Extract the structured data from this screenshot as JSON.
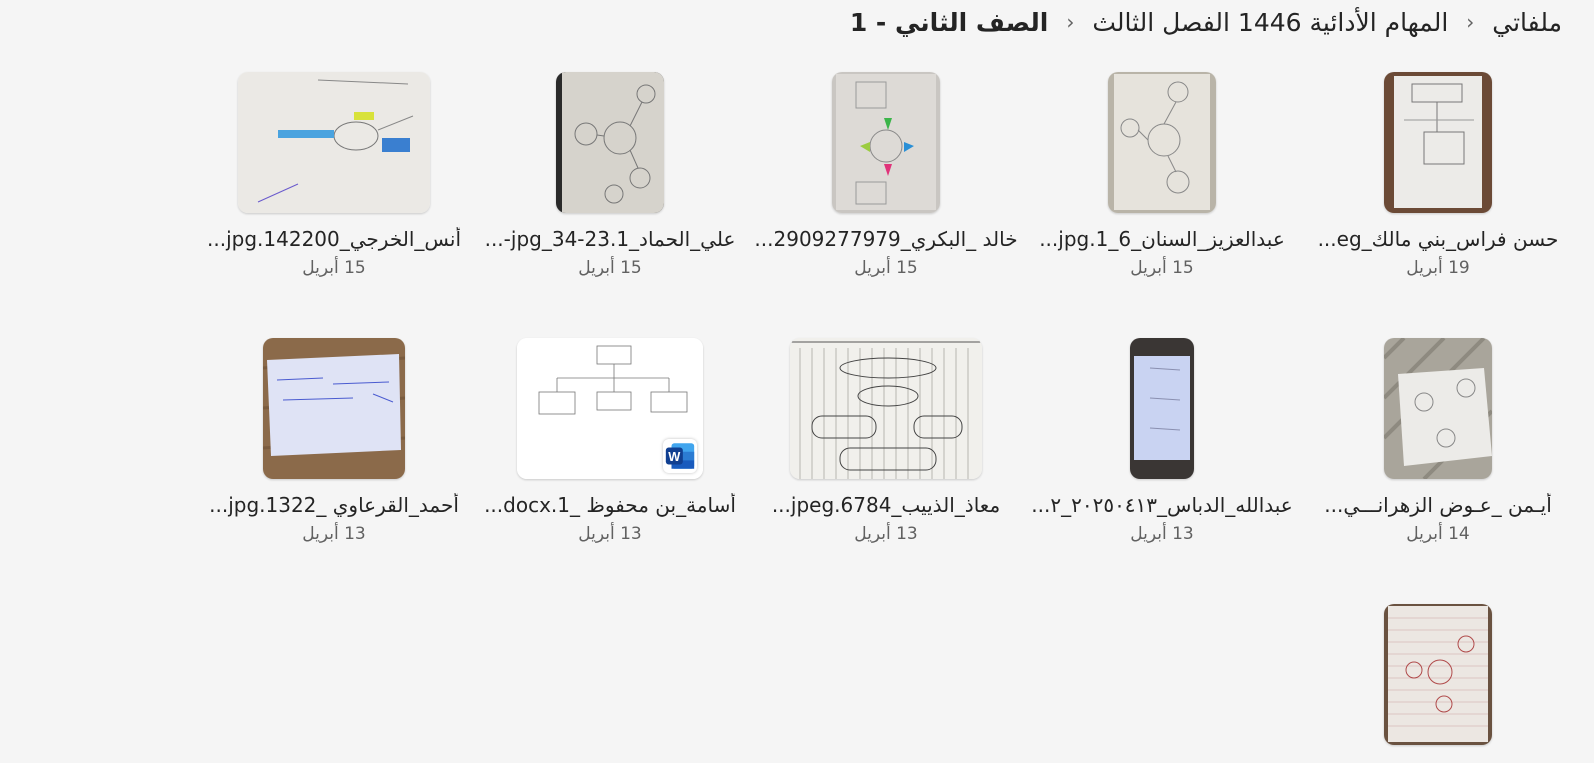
{
  "breadcrumb": {
    "items": [
      {
        "label": "ملفاتي"
      },
      {
        "label": "المهام الأدائية 1446 الفصل الثالث"
      },
      {
        "label": "الصف الثاني - 1"
      }
    ],
    "separator_icon": "chevron-left-icon"
  },
  "files": [
    {
      "name": "حسن فراس_بني مالك_eg...",
      "date": "19 أبريل",
      "type": "image"
    },
    {
      "name": "عبدالعزيز_السنان_6_1.jpg...",
      "date": "15 أبريل",
      "type": "image"
    },
    {
      "name": "خالد _البكري_2909277979...",
      "date": "15 أبريل",
      "type": "image"
    },
    {
      "name": "علي_الحماد_1.jpg_34-23-...",
      "date": "15 أبريل",
      "type": "image"
    },
    {
      "name": "أنس_الخرجي_142200.jpg...",
      "date": "15 أبريل",
      "type": "image"
    },
    {
      "name": "أيـمن _عـوض الزهرانـــي...",
      "date": "14 أبريل",
      "type": "image"
    },
    {
      "name": "عبدالله_الدباس_٢٠٢٥٠٤١٣_٢...",
      "date": "13 أبريل",
      "type": "image"
    },
    {
      "name": "معاذ_الذييب_6784.jpeg...",
      "date": "13 أبريل",
      "type": "image"
    },
    {
      "name": "أسامة_بن محفوظ _1.docx...",
      "date": "13 أبريل",
      "type": "docx",
      "badge_icon": "word-icon",
      "badge_letter": "W"
    },
    {
      "name": "أحمد_القرعاوي _1322.jpg...",
      "date": "13 أبريل",
      "type": "image"
    },
    {
      "name": "",
      "date": "",
      "type": "image"
    }
  ],
  "colors": {
    "background": "#f5f5f5",
    "text": "#242424",
    "secondary_text": "#616161",
    "word_blue": "#185abd"
  }
}
